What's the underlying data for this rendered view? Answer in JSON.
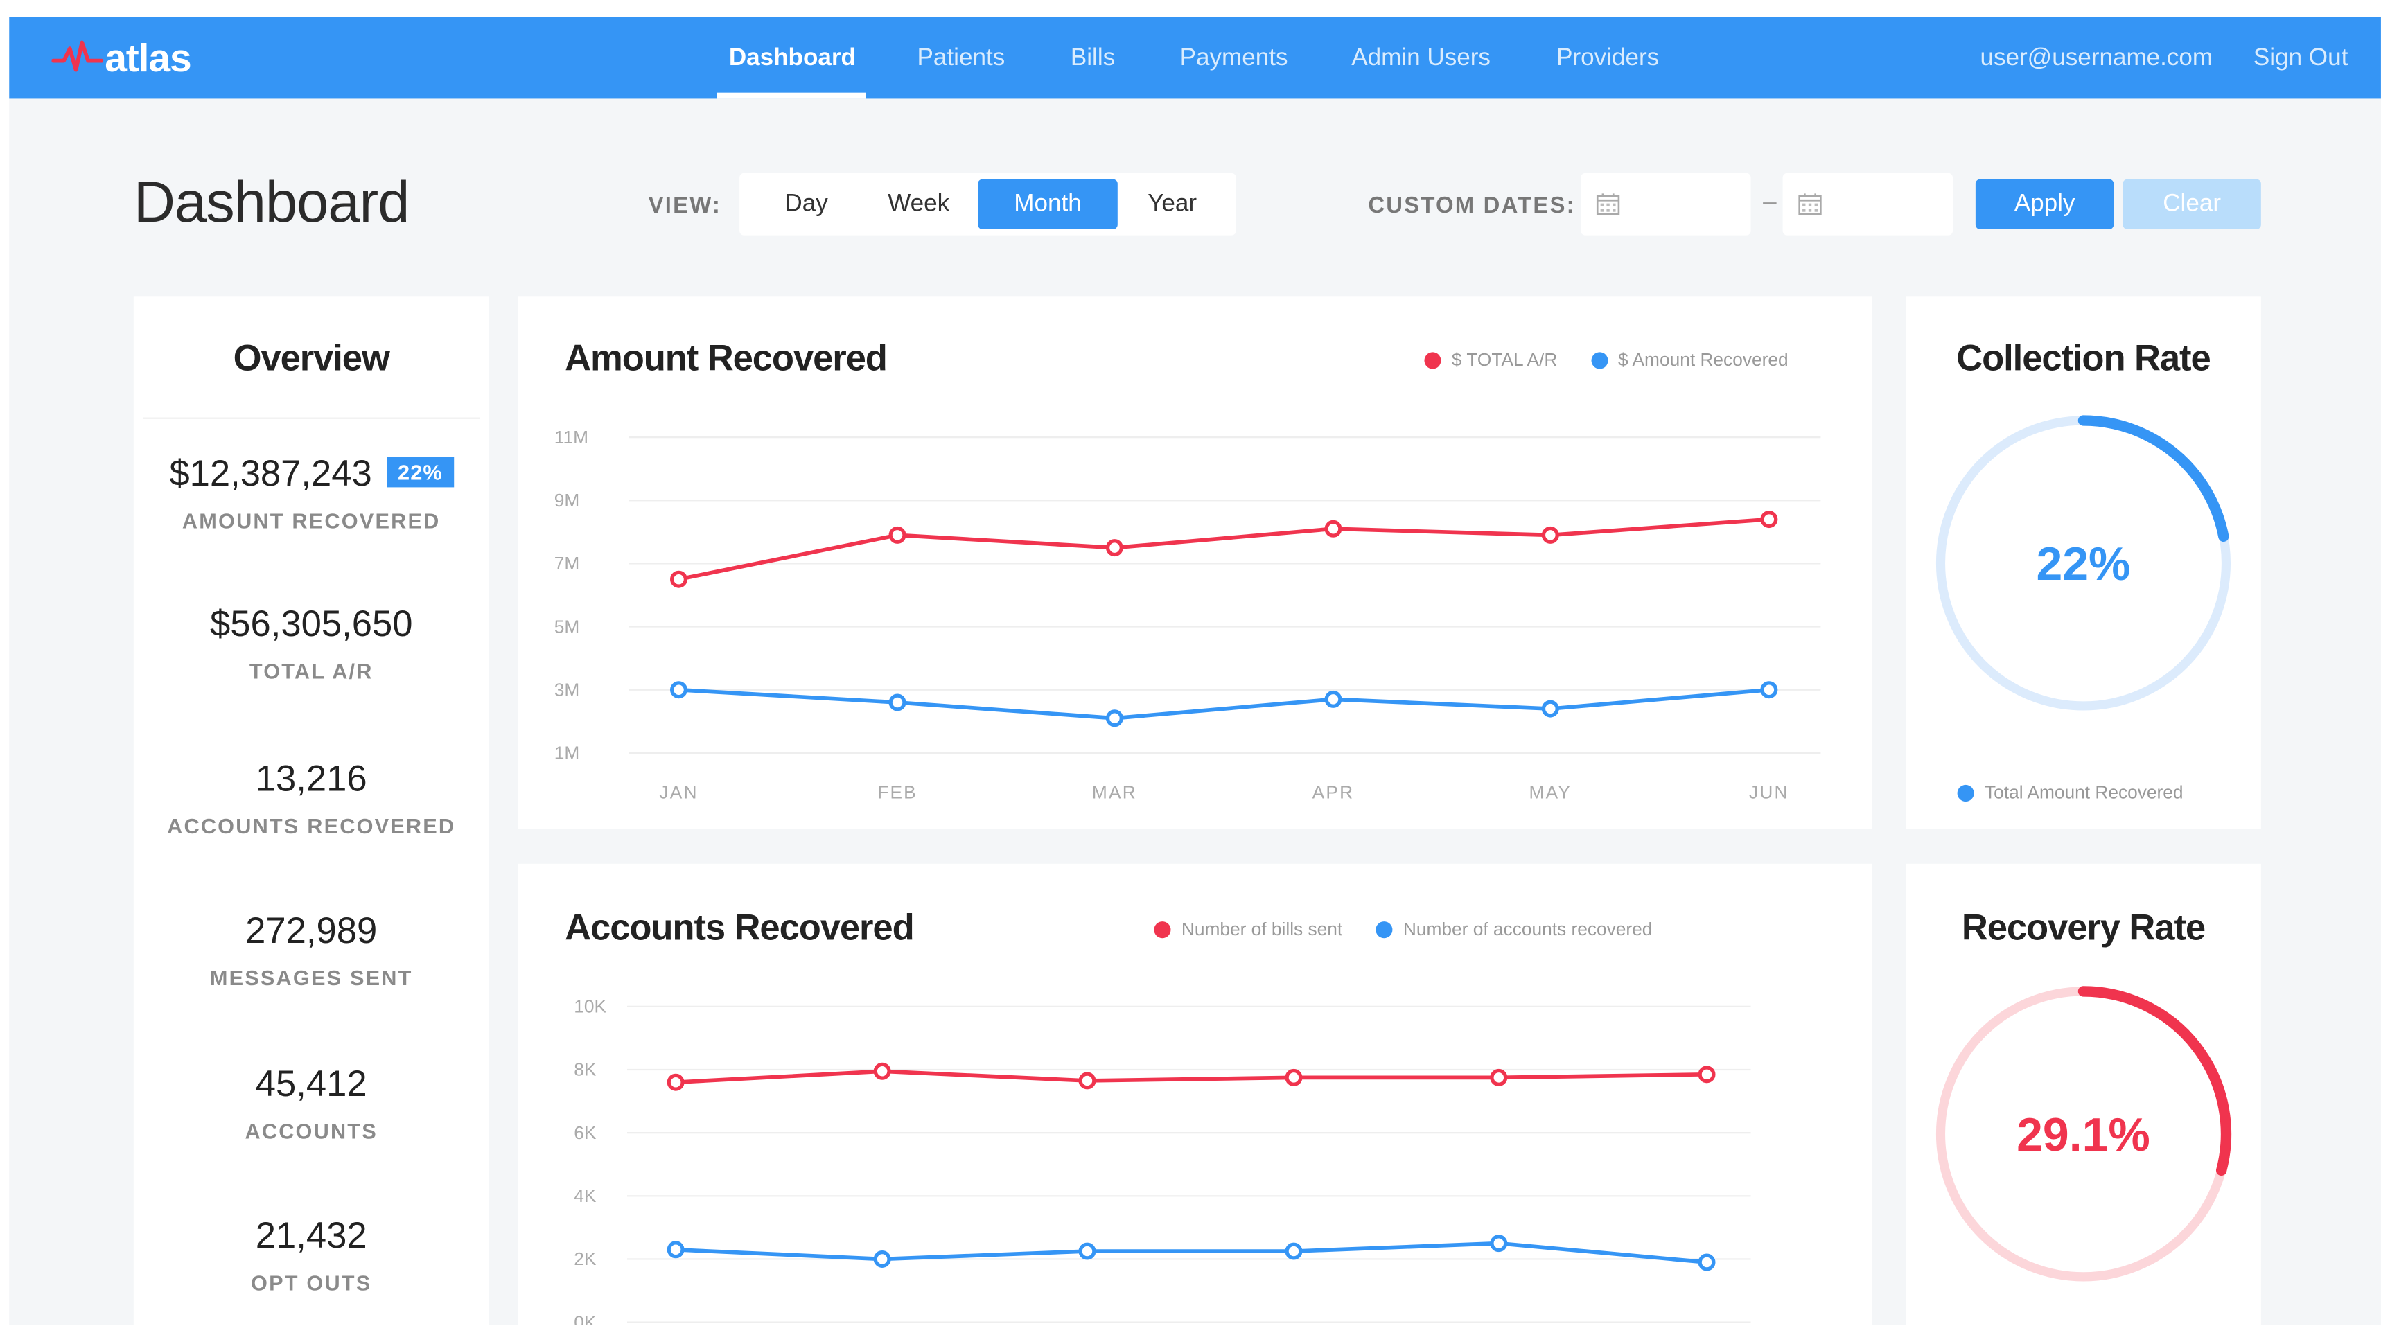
{
  "app": {
    "logo_text": "atlas",
    "nav": [
      "Dashboard",
      "Patients",
      "Bills",
      "Payments",
      "Admin Users",
      "Providers"
    ],
    "active_nav": "Dashboard",
    "user_email": "user@username.com",
    "sign_out": "Sign Out"
  },
  "header": {
    "title": "Dashboard",
    "view_label": "VIEW:",
    "view_options": [
      "Day",
      "Week",
      "Month",
      "Year"
    ],
    "active_view": "Month",
    "custom_dates_label": "CUSTOM DATES:",
    "date_separator": "–",
    "start_date": "",
    "end_date": "",
    "apply_label": "Apply",
    "clear_label": "Clear"
  },
  "overview": {
    "title": "Overview",
    "stats": [
      {
        "value": "$12,387,243",
        "label": "AMOUNT RECOVERED",
        "badge": "22%"
      },
      {
        "value": "$56,305,650",
        "label": "TOTAL A/R"
      },
      {
        "value": "13,216",
        "label": "ACCOUNTS RECOVERED"
      },
      {
        "value": "272,989",
        "label": "MESSAGES SENT"
      },
      {
        "value": "45,412",
        "label": "ACCOUNTS"
      },
      {
        "value": "21,432",
        "label": "OPT OUTS"
      }
    ]
  },
  "colors": {
    "primary": "#3595f5",
    "red": "#f0344e",
    "light_blue": "#dcebfc",
    "light_red": "#fcd6da"
  },
  "chart_data": [
    {
      "type": "line",
      "title": "Amount Recovered",
      "categories": [
        "JAN",
        "FEB",
        "MAR",
        "APR",
        "MAY",
        "JUN"
      ],
      "y_ticks": [
        "11M",
        "9M",
        "7M",
        "5M",
        "3M",
        "1M"
      ],
      "ylim": [
        1,
        11
      ],
      "y_unit": "M",
      "series": [
        {
          "name": "$ TOTAL A/R",
          "color": "#f0344e",
          "values": [
            6.5,
            7.9,
            7.5,
            8.1,
            7.9,
            8.4
          ]
        },
        {
          "name": "$ Amount Recovered",
          "color": "#3595f5",
          "values": [
            3.0,
            2.6,
            2.1,
            2.7,
            2.4,
            3.0
          ]
        }
      ],
      "grid": true,
      "legend": "top-right"
    },
    {
      "type": "line",
      "title": "Accounts Recovered",
      "categories": [
        "",
        "",
        "",
        "",
        "",
        ""
      ],
      "y_ticks": [
        "10K",
        "8K",
        "6K",
        "4K",
        "2K",
        "0K"
      ],
      "ylim": [
        0,
        10
      ],
      "y_unit": "K",
      "series": [
        {
          "name": "Number of bills sent",
          "color": "#f0344e",
          "values": [
            7.6,
            7.95,
            7.65,
            7.75,
            7.75,
            7.85
          ]
        },
        {
          "name": "Number of accounts recovered",
          "color": "#3595f5",
          "values": [
            2.3,
            2.0,
            2.25,
            2.25,
            2.5,
            1.9
          ]
        }
      ],
      "grid": true,
      "legend": "top-right"
    },
    {
      "type": "pie",
      "title": "Collection Rate",
      "value_label": "22%",
      "fraction": 0.22,
      "color": "#3595f5",
      "track_color": "#dcebfc",
      "legend": [
        "Total Amount Recovered"
      ]
    },
    {
      "type": "pie",
      "title": "Recovery Rate",
      "value_label": "29.1%",
      "fraction": 0.291,
      "color": "#f0344e",
      "track_color": "#fcd6da"
    }
  ]
}
